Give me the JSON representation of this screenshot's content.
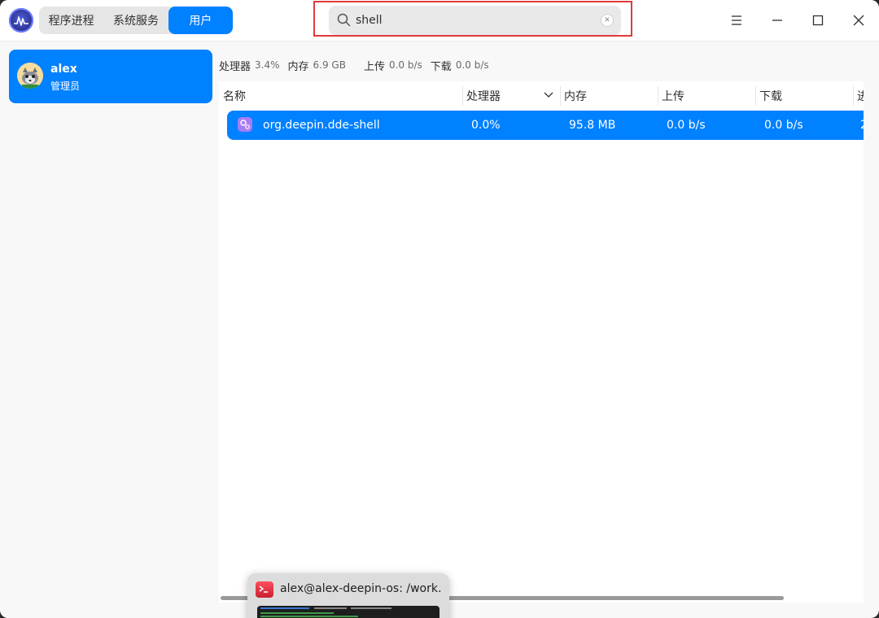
{
  "tabs": [
    {
      "label": "程序进程",
      "active": false
    },
    {
      "label": "系统服务",
      "active": false
    },
    {
      "label": "用户",
      "active": true
    }
  ],
  "search": {
    "value": "shell",
    "placeholder": ""
  },
  "window_controls": {
    "menu": "menu-icon",
    "minimize": "minimize-icon",
    "maximize": "maximize-icon",
    "close": "close-icon"
  },
  "user": {
    "name": "alex",
    "role": "管理员"
  },
  "summary": {
    "cpu_label": "处理器",
    "cpu_value": "3.4%",
    "mem_label": "内存",
    "mem_value": "6.9 GB",
    "up_label": "上传",
    "up_value": "0.0 b/s",
    "down_label": "下载",
    "down_value": "0.0 b/s"
  },
  "table": {
    "columns": [
      "名称",
      "处理器",
      "内存",
      "上传",
      "下载",
      "进"
    ],
    "rows": [
      {
        "name": "org.deepin.dde-shell",
        "cpu": "0.0%",
        "mem": "95.8 MB",
        "up": "0.0 b/s",
        "down": "0.0 b/s",
        "extra": "2"
      }
    ]
  },
  "preview": {
    "title": "alex@alex-deepin-os: /work…"
  },
  "colors": {
    "accent": "#0081ff",
    "highlight_border": "#e03a3a"
  }
}
